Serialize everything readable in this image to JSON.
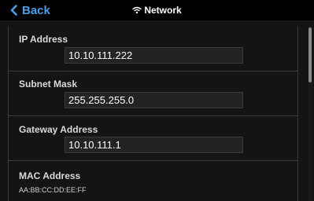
{
  "header": {
    "back_label": "Back",
    "title": "Network"
  },
  "fields": [
    {
      "label": "IP Address",
      "value": "10.10.111.222"
    },
    {
      "label": "Subnet Mask",
      "value": "255.255.255.0"
    },
    {
      "label": "Gateway Address",
      "value": "10.10.111.1"
    }
  ],
  "mac": {
    "label": "MAC Address",
    "value": "AA:BB:CC:DD:EE:FF"
  },
  "colors": {
    "accent": "#4a9fe8",
    "background": "#141414",
    "topbar": "#000000"
  },
  "icons": {
    "back": "chevron-left-icon",
    "title": "wifi-icon"
  }
}
